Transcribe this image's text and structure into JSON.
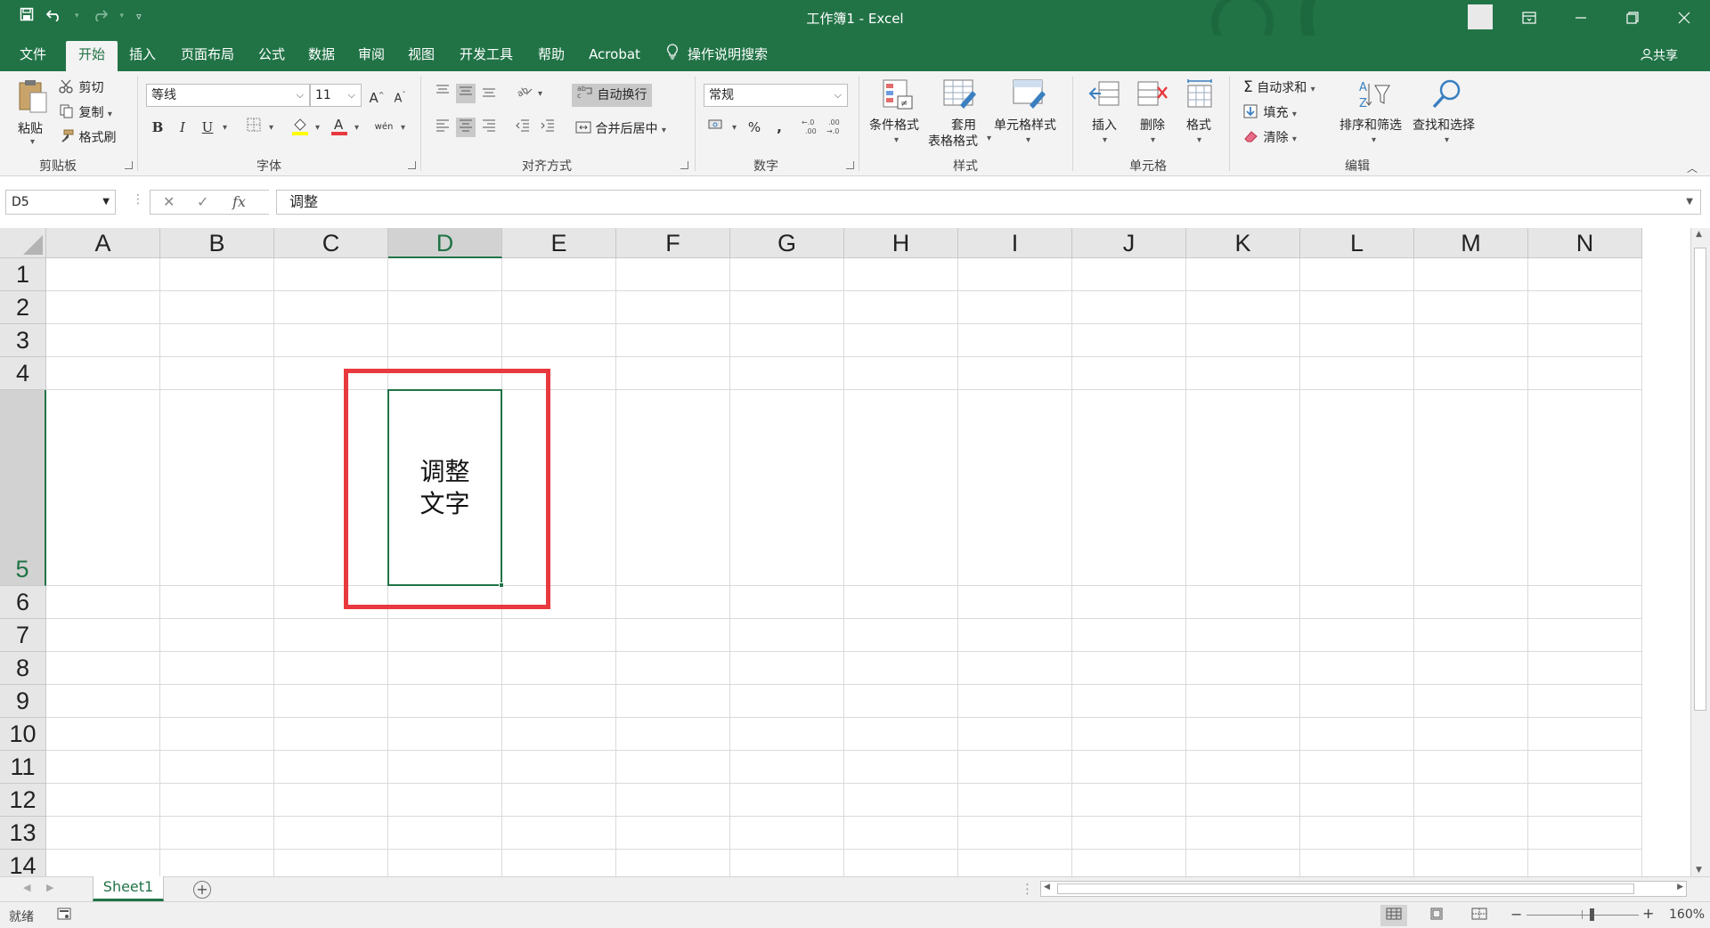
{
  "window": {
    "title": "工作簿1  -  Excel",
    "qat": {
      "save_icon": "save-icon",
      "undo_icon": "undo-icon",
      "redo_icon": "redo-icon",
      "customize_icon": "customize-qat-icon"
    },
    "controls": [
      "ribbon-display-options-icon",
      "minimize-icon",
      "restore-icon",
      "close-icon"
    ]
  },
  "menu": {
    "tabs": [
      "文件",
      "开始",
      "插入",
      "页面布局",
      "公式",
      "数据",
      "审阅",
      "视图",
      "开发工具",
      "帮助",
      "Acrobat",
      "操作说明搜索"
    ],
    "active_tab": "开始",
    "share": "共享"
  },
  "ribbon": {
    "clipboard": {
      "label": "剪贴板",
      "paste": "粘贴",
      "cut": "剪切",
      "copy": "复制",
      "format_painter": "格式刷"
    },
    "font": {
      "label": "字体",
      "font_name": "等线",
      "font_size": "11",
      "grow": "A",
      "shrink": "A",
      "bold": "B",
      "italic": "I",
      "underline": "U",
      "phonetic": "wén"
    },
    "alignment": {
      "label": "对齐方式",
      "wrap_text": "自动换行",
      "merge_center": "合并后居中"
    },
    "number": {
      "label": "数字",
      "format": "常规",
      "percent": "%",
      "comma": ",",
      "inc_decimal": "←.0\n.00",
      "dec_decimal": ".00\n→.0"
    },
    "styles": {
      "label": "样式",
      "conditional": "条件格式",
      "table_line1": "套用",
      "table_line2": "表格格式",
      "cell_styles": "单元格样式"
    },
    "cells": {
      "label": "单元格",
      "insert": "插入",
      "delete": "删除",
      "format": "格式"
    },
    "editing": {
      "label": "编辑",
      "autosum": "自动求和",
      "fill": "填充",
      "clear": "清除",
      "sort_filter": "排序和筛选",
      "find_select": "查找和选择"
    }
  },
  "formula_bar": {
    "name_box": "D5",
    "cancel": "✕",
    "enter": "✓",
    "fx": "fx",
    "content": "调整"
  },
  "grid": {
    "columns": [
      "A",
      "B",
      "C",
      "D",
      "E",
      "F",
      "G",
      "H",
      "I",
      "J",
      "K",
      "L",
      "M",
      "N"
    ],
    "rows": [
      "1",
      "2",
      "3",
      "4",
      "5",
      "6",
      "7",
      "8",
      "9",
      "10",
      "11",
      "12",
      "13",
      "14"
    ],
    "selected_column": "D",
    "selected_row": "5",
    "active_cell_line1": "调整",
    "active_cell_line2": "文字"
  },
  "sheets": {
    "tabs": [
      "Sheet1"
    ],
    "add": "+"
  },
  "status": {
    "ready": "就绪",
    "zoom": "160%",
    "zoom_minus": "−",
    "zoom_plus": "+"
  },
  "colors": {
    "excel_green": "#217346",
    "highlight_red": "#e8393e"
  }
}
